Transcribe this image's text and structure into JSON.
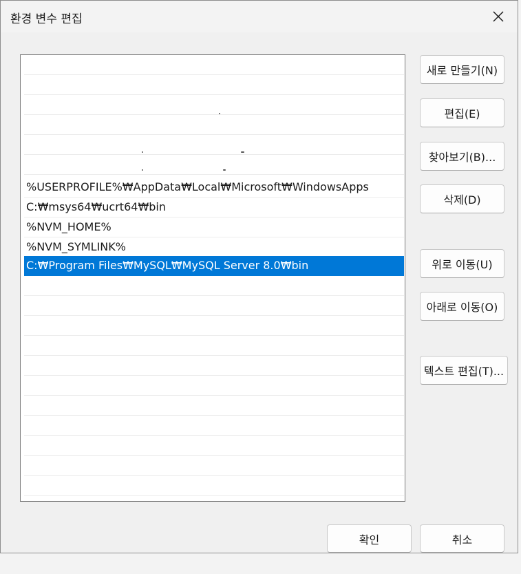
{
  "dialog": {
    "title": "환경 변수 편집",
    "close_icon": "close-icon"
  },
  "list": {
    "items": [
      "",
      "",
      "",
      "",
      "",
      "",
      "%USERPROFILE%₩AppData₩Local₩Microsoft₩WindowsApps",
      "C:₩msys64₩ucrt64₩bin",
      "%NVM_HOME%",
      "%NVM_SYMLINK%",
      "C:₩Program Files₩MySQL₩MySQL Server 8.0₩bin"
    ],
    "selected_index": 10
  },
  "buttons": {
    "new": "새로 만들기(N)",
    "edit": "편집(E)",
    "browse": "찾아보기(B)...",
    "delete": "삭제(D)",
    "move_up": "위로 이동(U)",
    "move_down": "아래로 이동(O)",
    "edit_text": "텍스트 편집(T)...",
    "ok": "확인",
    "cancel": "취소"
  },
  "colors": {
    "selection": "#0078d7",
    "dialog_bg": "#f0f0f0"
  }
}
